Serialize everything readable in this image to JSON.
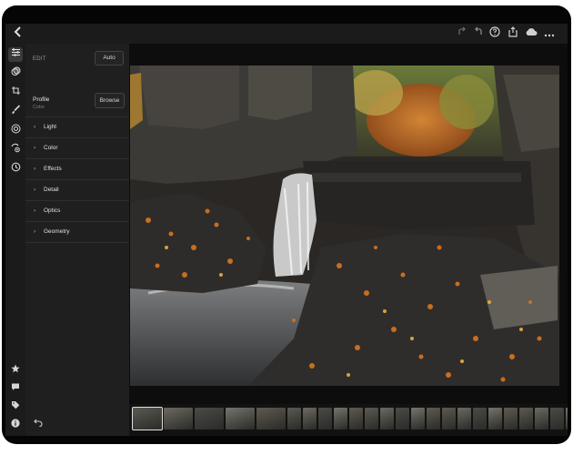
{
  "edit_panel": {
    "title": "EDIT",
    "auto_label": "Auto",
    "profile_label": "Profile",
    "profile_value": "Color",
    "browse_label": "Browse",
    "sections": [
      {
        "label": "Light"
      },
      {
        "label": "Color"
      },
      {
        "label": "Effects"
      },
      {
        "label": "Detail"
      },
      {
        "label": "Optics"
      },
      {
        "label": "Geometry"
      }
    ]
  },
  "topbar": {
    "icons": [
      "back-icon",
      "redo-icon",
      "undo-icon",
      "help-icon",
      "share-icon",
      "cloud-sync-icon",
      "more-icon"
    ]
  },
  "toolstrip": {
    "icons": [
      "edit-sliders-icon",
      "presets-icon",
      "crop-icon",
      "brush-icon",
      "radial-filter-icon",
      "healing-icon",
      "versions-icon"
    ],
    "bottom_icons": [
      "star-icon",
      "comment-icon",
      "tag-icon",
      "info-icon"
    ]
  },
  "filmstrip": {
    "thumbnail_count": 26,
    "selected_index": 0
  },
  "colors": {
    "background": "#1b1b1b",
    "panel": "#1f1f1f",
    "text": "#e0e0e0",
    "accent_foliage": "#c8661d"
  }
}
